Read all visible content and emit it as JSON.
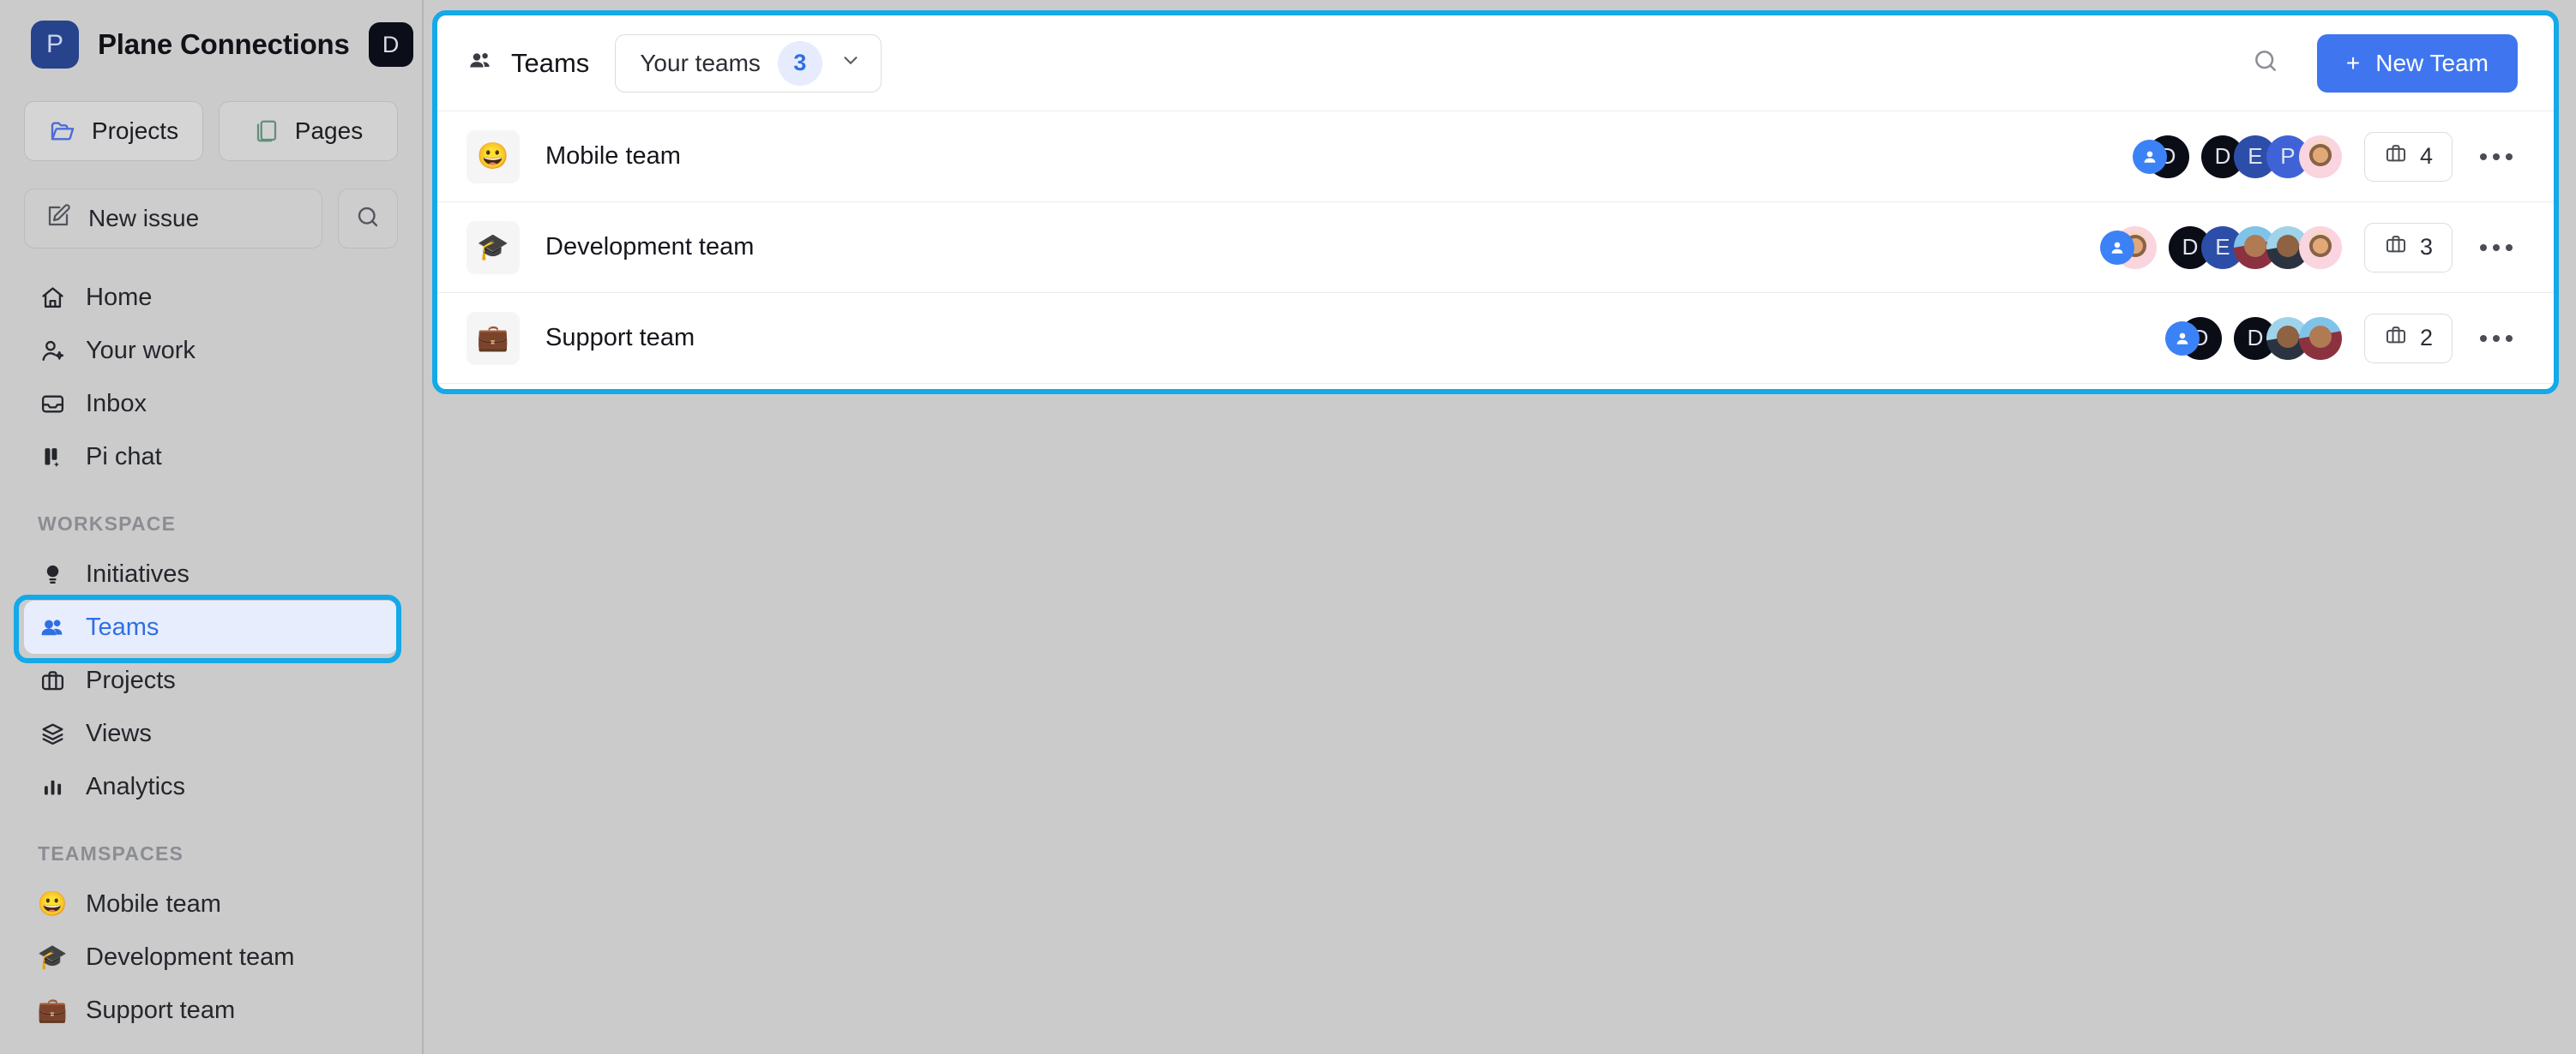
{
  "brand": {
    "logo_letter": "P",
    "name": "Plane Connections",
    "avatar_letter": "D"
  },
  "sidebar": {
    "tabs": [
      {
        "label": "Projects",
        "icon": "folder-open-icon",
        "active": true
      },
      {
        "label": "Pages",
        "icon": "pages-icon",
        "active": false
      }
    ],
    "new_issue": {
      "label": "New issue",
      "icon": "pencil-square-icon"
    },
    "search_icon": "search-icon",
    "nav": [
      {
        "label": "Home",
        "icon": "home-icon"
      },
      {
        "label": "Your work",
        "icon": "user-sparkle-icon"
      },
      {
        "label": "Inbox",
        "icon": "inbox-icon"
      },
      {
        "label": "Pi chat",
        "icon": "pi-chat-icon"
      }
    ],
    "workspace_label": "WORKSPACE",
    "workspace": [
      {
        "label": "Initiatives",
        "icon": "lightbulb-icon",
        "selected": false
      },
      {
        "label": "Teams",
        "icon": "teams-icon",
        "selected": true
      },
      {
        "label": "Projects",
        "icon": "briefcase-icon",
        "selected": false
      },
      {
        "label": "Views",
        "icon": "layers-icon",
        "selected": false
      },
      {
        "label": "Analytics",
        "icon": "bar-chart-icon",
        "selected": false
      }
    ],
    "teamspaces_label": "TEAMSPACES",
    "teamspaces": [
      {
        "label": "Mobile team",
        "emoji": "😀"
      },
      {
        "label": "Development team",
        "emoji": "🎓"
      },
      {
        "label": "Support team",
        "emoji": "💼"
      }
    ]
  },
  "panel": {
    "title": "Teams",
    "title_icon": "teams-icon",
    "filter": {
      "label": "Your teams",
      "count": "3",
      "chevron": "chevron-down-icon"
    },
    "search_icon": "search-icon",
    "new_team": {
      "label": "New Team",
      "plus": "+"
    },
    "rows": [
      {
        "emoji": "😀",
        "name": "Mobile team",
        "lead": {
          "type": "badge-letter",
          "letter": "D",
          "bg": "dark"
        },
        "members": [
          {
            "type": "letter",
            "letter": "D",
            "bg": "dark"
          },
          {
            "type": "letter",
            "letter": "E",
            "bg": "blue1"
          },
          {
            "type": "letter",
            "letter": "P",
            "bg": "blue2"
          },
          {
            "type": "photo",
            "variant": "a"
          }
        ],
        "projects_count": "4",
        "projects_icon": "briefcase-icon",
        "menu_icon": "ellipsis-icon"
      },
      {
        "emoji": "🎓",
        "name": "Development team",
        "lead": {
          "type": "badge-photo",
          "variant": "a"
        },
        "members": [
          {
            "type": "letter",
            "letter": "D",
            "bg": "dark"
          },
          {
            "type": "letter",
            "letter": "E",
            "bg": "blue1"
          },
          {
            "type": "photo",
            "variant": "b"
          },
          {
            "type": "photo",
            "variant": "c"
          },
          {
            "type": "photo",
            "variant": "a"
          }
        ],
        "projects_count": "3",
        "projects_icon": "briefcase-icon",
        "menu_icon": "ellipsis-icon"
      },
      {
        "emoji": "💼",
        "name": "Support team",
        "lead": {
          "type": "badge-letter",
          "letter": "D",
          "bg": "dark"
        },
        "members": [
          {
            "type": "letter",
            "letter": "D",
            "bg": "dark"
          },
          {
            "type": "photo",
            "variant": "c"
          },
          {
            "type": "photo",
            "variant": "b"
          }
        ],
        "projects_count": "2",
        "projects_icon": "briefcase-icon",
        "menu_icon": "ellipsis-icon"
      }
    ]
  },
  "colors": {
    "accent_blue": "#3f76ef",
    "highlight_cyan": "#14a9e8",
    "selected_bg": "#e8edfd",
    "selected_text": "#2f6fe4"
  }
}
